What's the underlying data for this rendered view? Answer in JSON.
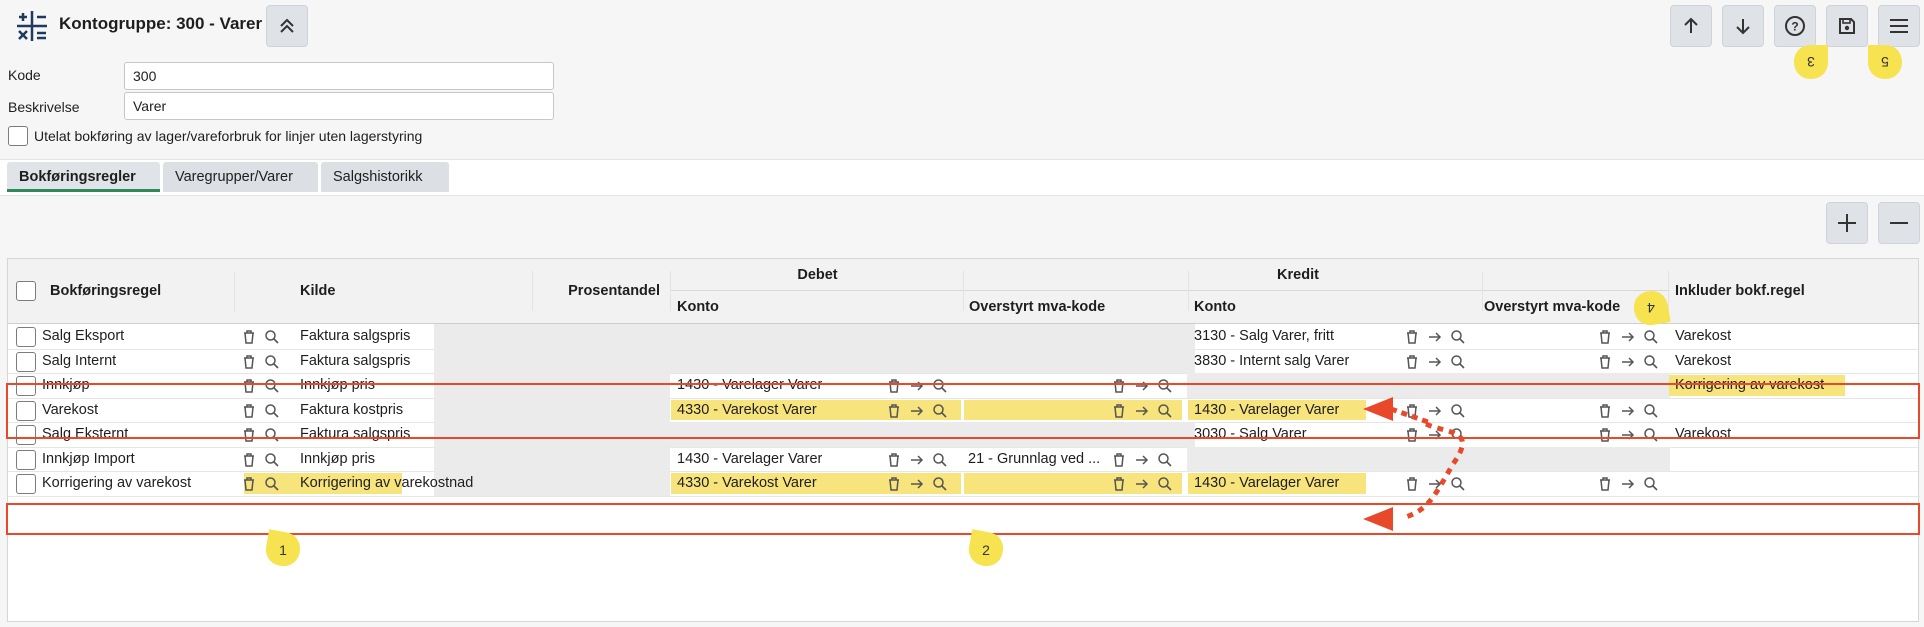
{
  "header": {
    "title": "Kontogruppe: 300 - Varer",
    "kode_label": "Kode",
    "kode_value": "300",
    "beskrivelse_label": "Beskrivelse",
    "beskrivelse_value": "Varer",
    "checkbox_label": "Utelat bokføring av lager/vareforbruk for linjer uten lagerstyring"
  },
  "toolbar_icons": [
    "arrow-up-icon",
    "arrow-down-icon",
    "help-icon",
    "save-icon",
    "menu-icon"
  ],
  "tabs": [
    "Bokføringsregler",
    "Varegrupper/Varer",
    "Salgshistorikk"
  ],
  "table": {
    "group_headers": {
      "debet": "Debet",
      "kredit": "Kredit"
    },
    "columns": {
      "bokforingsregel": "Bokføringsregel",
      "kilde": "Kilde",
      "prosentandel": "Prosentandel",
      "debet_konto": "Konto",
      "debet_mva": "Overstyrt mva-kode",
      "kredit_konto": "Konto",
      "kredit_mva": "Overstyrt mva-kode",
      "inkluder": "Inkluder bokf.regel"
    },
    "rows": [
      {
        "regel": "Salg Eksport",
        "kilde": "Faktura salgspris",
        "debet_konto": "",
        "debet_mva": "",
        "kredit_konto": "3130 - Salg Varer, fritt",
        "kredit_mva": "",
        "inkluder": "Varekost"
      },
      {
        "regel": "Salg Internt",
        "kilde": "Faktura salgspris",
        "debet_konto": "",
        "debet_mva": "",
        "kredit_konto": "3830 - Internt salg Varer",
        "kredit_mva": "",
        "inkluder": "Varekost"
      },
      {
        "regel": "Innkjøp",
        "kilde": "Innkjøp pris",
        "debet_konto": "1430 - Varelager Varer",
        "debet_mva": "",
        "kredit_konto": "",
        "kredit_mva": "",
        "inkluder": "Korrigering av varekost"
      },
      {
        "regel": "Varekost",
        "kilde": "Faktura kostpris",
        "debet_konto": "4330 - Varekost Varer",
        "debet_mva": "",
        "kredit_konto": "1430 - Varelager Varer",
        "kredit_mva": "",
        "inkluder": ""
      },
      {
        "regel": "Salg Eksternt",
        "kilde": "Faktura salgspris",
        "debet_konto": "",
        "debet_mva": "",
        "kredit_konto": "3030 - Salg Varer",
        "kredit_mva": "",
        "inkluder": "Varekost"
      },
      {
        "regel": "Innkjøp Import",
        "kilde": "Innkjøp pris",
        "debet_konto": "1430 - Varelager Varer",
        "debet_mva": "21 - Grunnlag ved ...",
        "kredit_konto": "",
        "kredit_mva": "",
        "inkluder": ""
      },
      {
        "regel": "Korrigering av varekost",
        "kilde": "Korrigering av varekostnad",
        "debet_konto": "4330 - Varekost Varer",
        "debet_mva": "",
        "kredit_konto": "1430 - Varelager Varer",
        "kredit_mva": "",
        "inkluder": ""
      }
    ]
  },
  "annotations": [
    "1",
    "2",
    "3",
    "4",
    "5"
  ],
  "colors": {
    "highlight": "#f7e47d",
    "annotation_box": "#e8492a",
    "marker": "#f7e34f"
  }
}
